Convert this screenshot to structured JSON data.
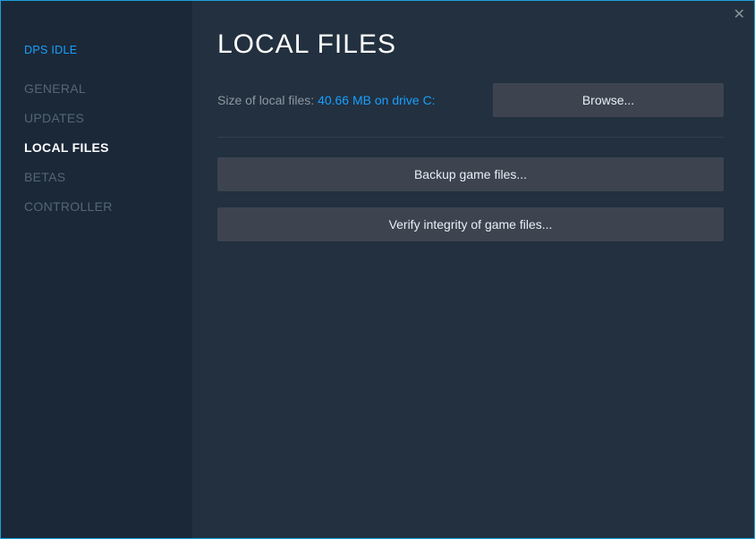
{
  "header": {
    "app_name": "DPS IDLE"
  },
  "sidebar": {
    "items": [
      {
        "label": "GENERAL",
        "active": false
      },
      {
        "label": "UPDATES",
        "active": false
      },
      {
        "label": "LOCAL FILES",
        "active": true
      },
      {
        "label": "BETAS",
        "active": false
      },
      {
        "label": "CONTROLLER",
        "active": false
      }
    ]
  },
  "main": {
    "title": "LOCAL FILES",
    "size_label": "Size of local files: ",
    "size_value": "40.66 MB on drive C:",
    "browse_button": "Browse...",
    "backup_button": "Backup game files...",
    "verify_button": "Verify integrity of game files..."
  }
}
